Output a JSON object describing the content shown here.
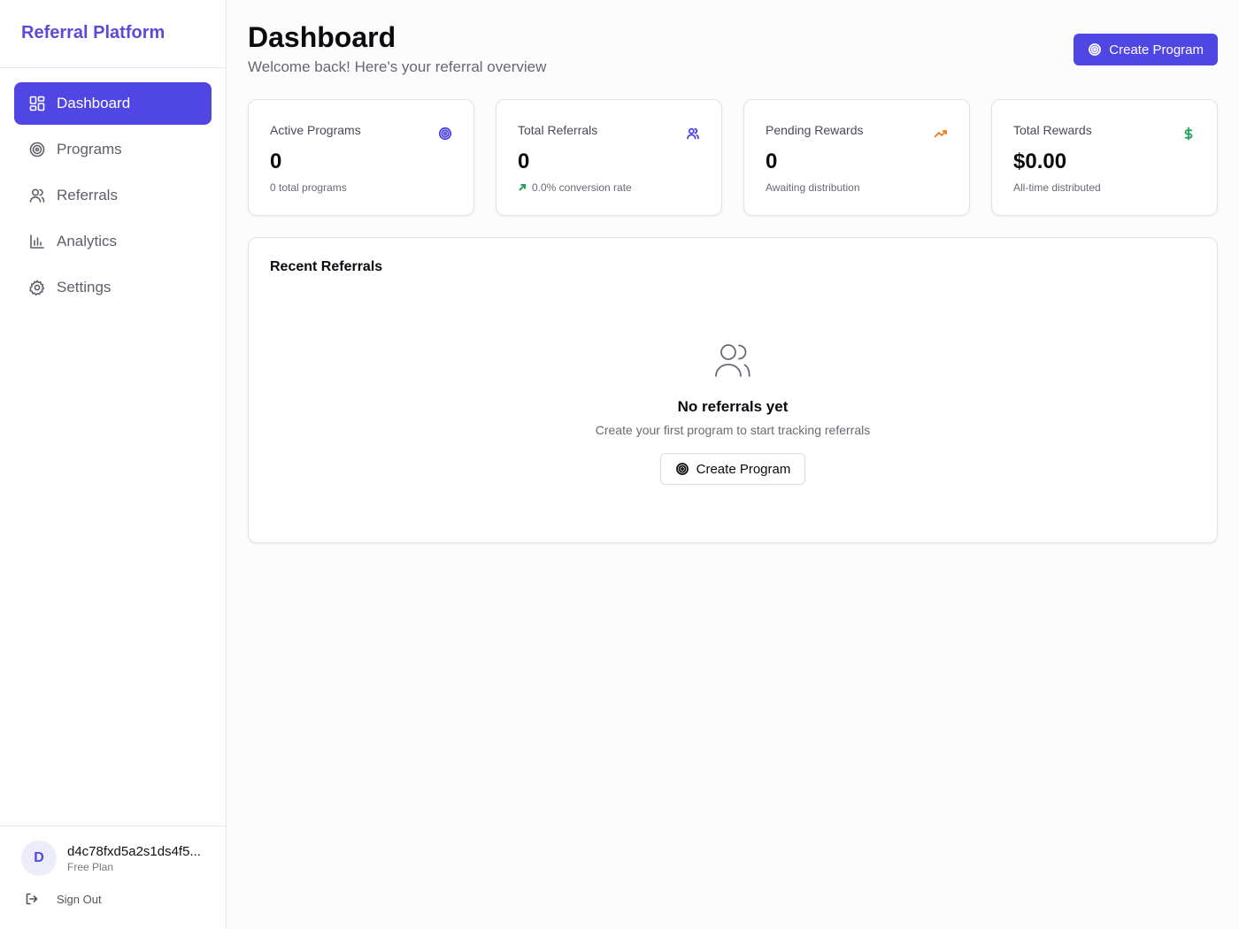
{
  "app": {
    "brand": "Referral Platform"
  },
  "sidebar": {
    "items": [
      {
        "label": "Dashboard",
        "icon": "layout-grid-icon",
        "active": true
      },
      {
        "label": "Programs",
        "icon": "target-icon",
        "active": false
      },
      {
        "label": "Referrals",
        "icon": "users-icon",
        "active": false
      },
      {
        "label": "Analytics",
        "icon": "bar-chart-icon",
        "active": false
      },
      {
        "label": "Settings",
        "icon": "gear-icon",
        "active": false
      }
    ],
    "user": {
      "avatar_initial": "D",
      "name": "d4c78fxd5a2s1ds4f5...",
      "plan": "Free Plan"
    },
    "sign_out_label": "Sign Out"
  },
  "header": {
    "title": "Dashboard",
    "subtitle": "Welcome back! Here's your referral overview",
    "create_button_label": "Create Program"
  },
  "stats": [
    {
      "label": "Active Programs",
      "value": "0",
      "sub": "0 total programs",
      "icon": "target-icon",
      "icon_color": "#5046e4"
    },
    {
      "label": "Total Referrals",
      "value": "0",
      "sub": "0.0% conversion rate",
      "icon": "users-icon",
      "icon_color": "#5046e4"
    },
    {
      "label": "Pending Rewards",
      "value": "0",
      "sub": "Awaiting distribution",
      "icon": "trending-up-icon",
      "icon_color": "#f07a1a"
    },
    {
      "label": "Total Rewards",
      "value": "$0.00",
      "sub": "All-time distributed",
      "icon": "dollar-icon",
      "icon_color": "#22a35a"
    }
  ],
  "recent": {
    "title": "Recent Referrals",
    "empty_title": "No referrals yet",
    "empty_subtitle": "Create your first program to start tracking referrals",
    "empty_button_label": "Create Program"
  },
  "colors": {
    "accent": "#5046e4",
    "brand_text": "#5b4bd8"
  }
}
